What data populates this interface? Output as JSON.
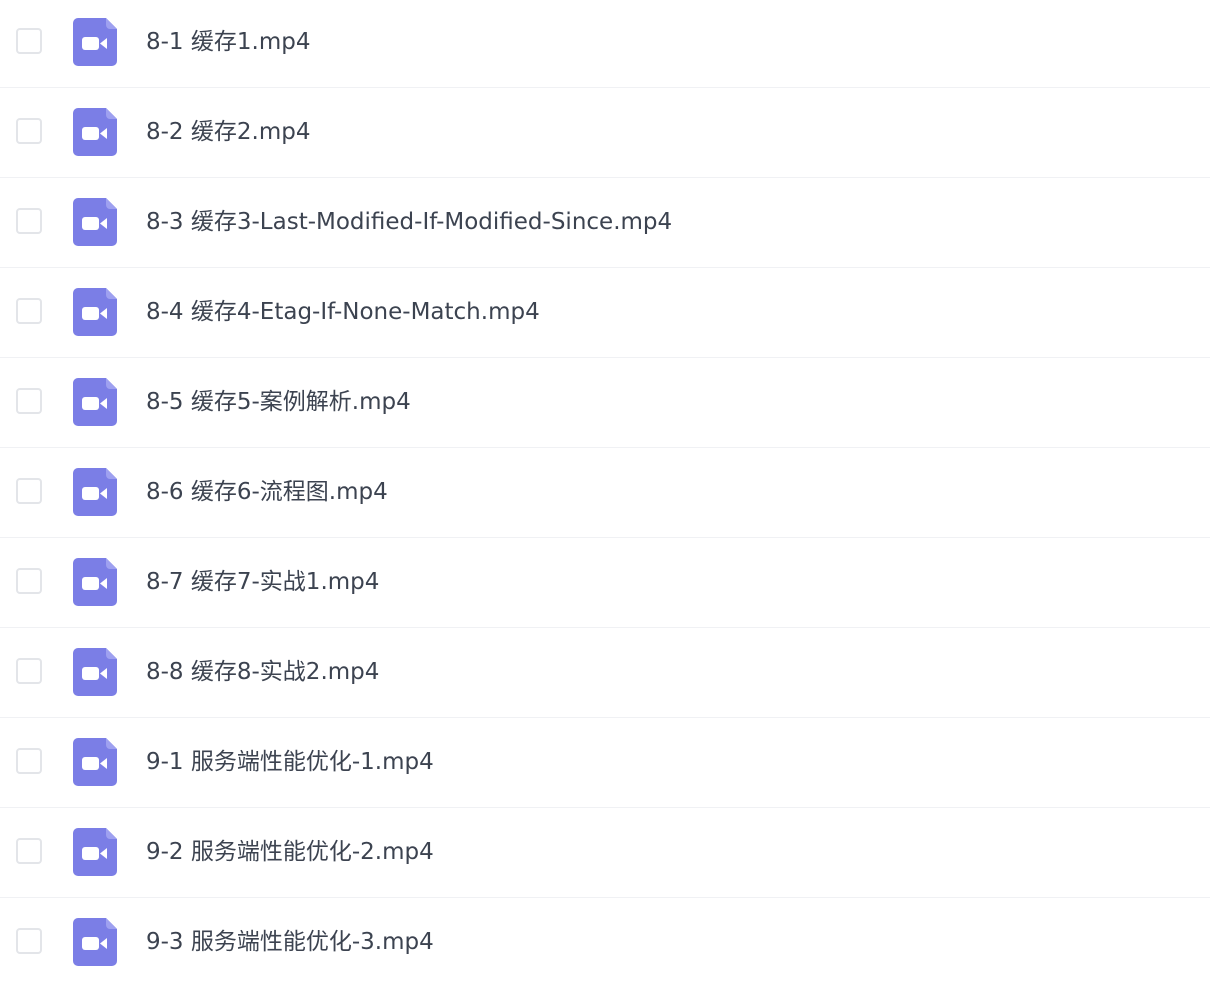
{
  "icons": {
    "file_type_icon": "video-file-icon",
    "icon_color": "#7b7ee6",
    "icon_glyph_color": "#ffffff"
  },
  "files": [
    {
      "name": "8-1 缓存1.mp4",
      "checked": false
    },
    {
      "name": "8-2 缓存2.mp4",
      "checked": false
    },
    {
      "name": "8-3 缓存3-Last-Modified-If-Modified-Since.mp4",
      "checked": false
    },
    {
      "name": "8-4 缓存4-Etag-If-None-Match.mp4",
      "checked": false
    },
    {
      "name": "8-5 缓存5-案例解析.mp4",
      "checked": false
    },
    {
      "name": "8-6 缓存6-流程图.mp4",
      "checked": false
    },
    {
      "name": "8-7 缓存7-实战1.mp4",
      "checked": false
    },
    {
      "name": "8-8 缓存8-实战2.mp4",
      "checked": false
    },
    {
      "name": "9-1 服务端性能优化-1.mp4",
      "checked": false
    },
    {
      "name": "9-2 服务端性能优化-2.mp4",
      "checked": false
    },
    {
      "name": "9-3 服务端性能优化-3.mp4",
      "checked": false
    }
  ]
}
